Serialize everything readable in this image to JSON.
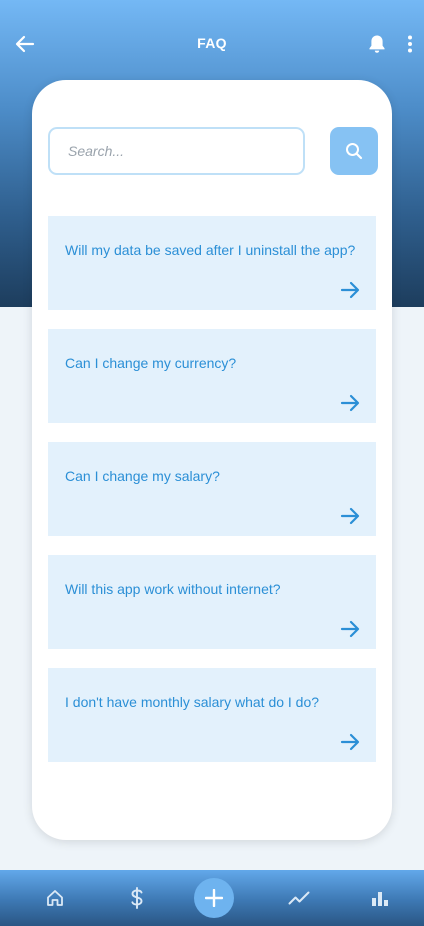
{
  "header": {
    "title": "FAQ",
    "back_icon": "arrow-left-icon",
    "bell_icon": "bell-icon",
    "more_icon": "more-vertical-icon"
  },
  "search": {
    "placeholder": "Search...",
    "value": "",
    "button_icon": "search-icon"
  },
  "faq": {
    "items": [
      {
        "question": "Will my data be saved after I uninstall the app?",
        "icon": "arrow-right-icon"
      },
      {
        "question": "Can I change my currency?",
        "icon": "arrow-right-icon"
      },
      {
        "question": "Can I change my salary?",
        "icon": "arrow-right-icon"
      },
      {
        "question": "Will this app work without internet?",
        "icon": "arrow-right-icon"
      },
      {
        "question": "I don't have monthly salary what do I do?",
        "icon": "arrow-right-icon"
      }
    ]
  },
  "bottom_nav": {
    "items": [
      {
        "name": "home",
        "icon": "home-icon"
      },
      {
        "name": "money",
        "icon": "dollar-icon"
      },
      {
        "name": "add",
        "icon": "plus-icon"
      },
      {
        "name": "trends",
        "icon": "trend-line-icon"
      },
      {
        "name": "stats",
        "icon": "bar-chart-icon"
      }
    ]
  },
  "colors": {
    "accent": "#2b8fd6",
    "faq_background": "#e3f1fc",
    "search_button": "#86c2f3",
    "header_top": "#74b8f5",
    "header_bottom": "#1d3d5d"
  }
}
